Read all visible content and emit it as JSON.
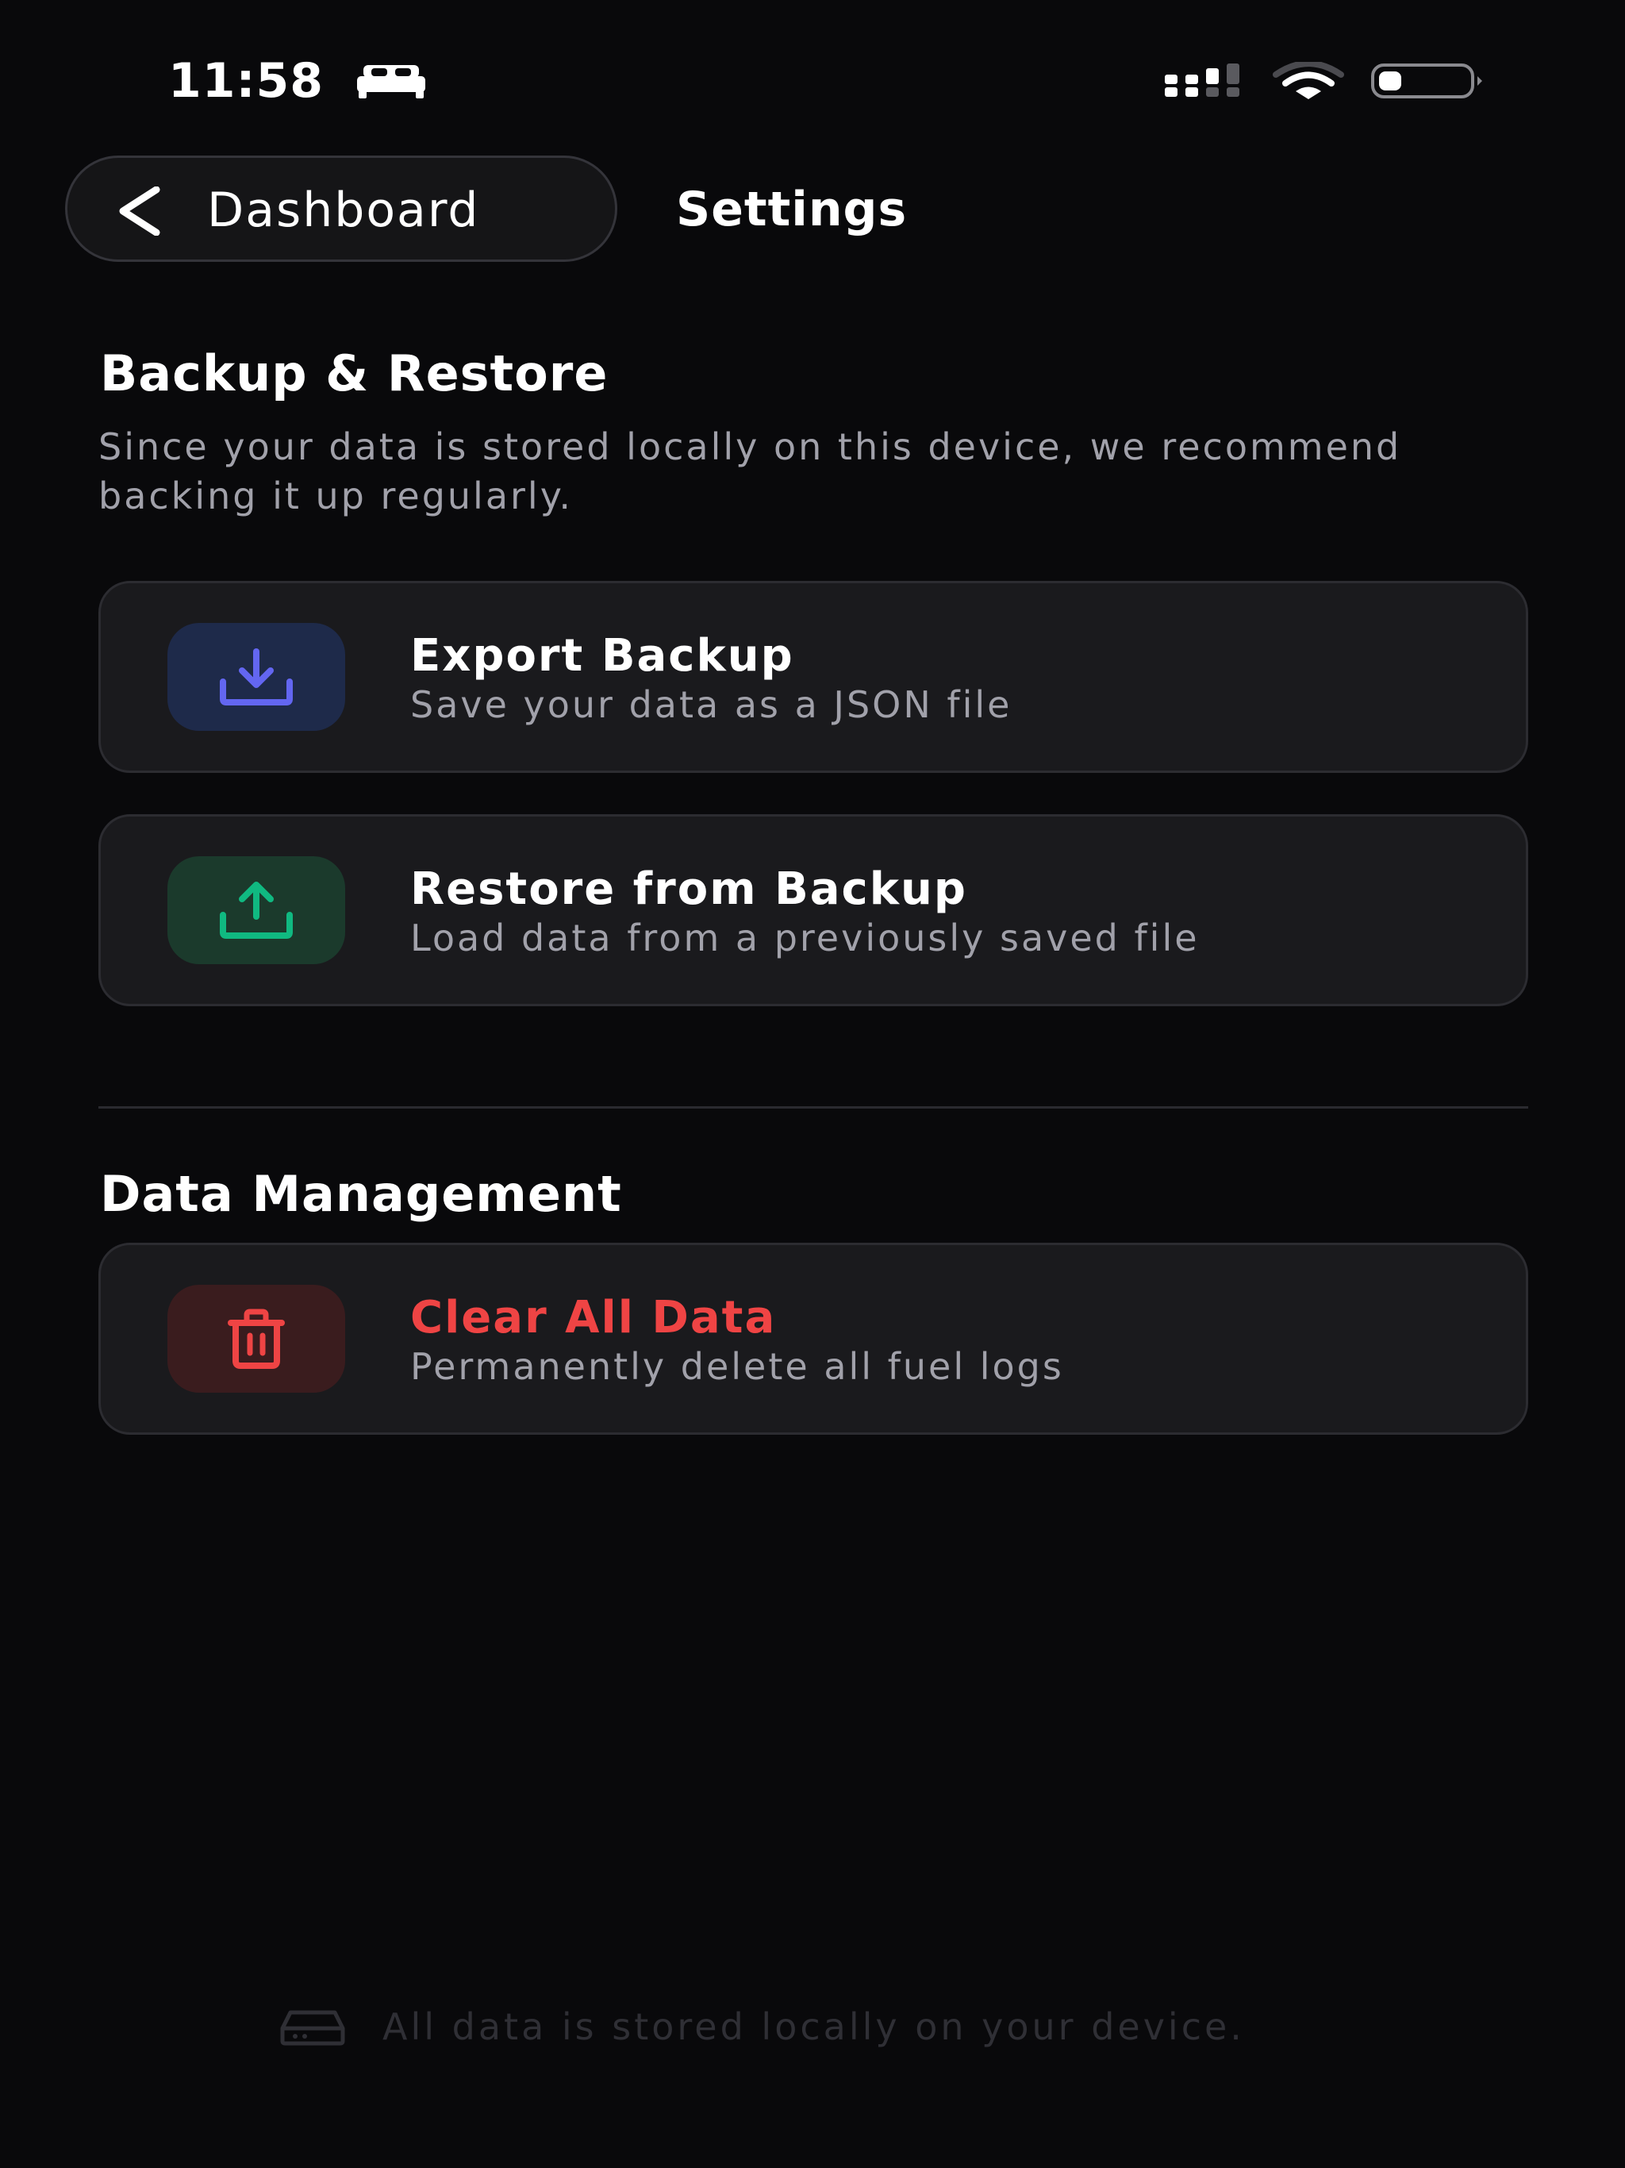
{
  "status_bar": {
    "time": "11:58"
  },
  "header": {
    "back_label": "Dashboard",
    "title": "Settings"
  },
  "backup_section": {
    "title": "Backup & Restore",
    "description": "Since your data is stored locally on this device, we recommend backing it up regularly.",
    "export": {
      "title": "Export Backup",
      "subtitle": "Save your data as a JSON file",
      "icon": "download-icon",
      "icon_color": "#6366f1",
      "icon_bg": "#1e2a4a"
    },
    "restore": {
      "title": "Restore from Backup",
      "subtitle": "Load data from a previously saved file",
      "icon": "upload-icon",
      "icon_color": "#10b981",
      "icon_bg": "#1b3a2c"
    }
  },
  "data_section": {
    "title": "Data Management",
    "clear": {
      "title": "Clear All Data",
      "subtitle": "Permanently delete all fuel logs",
      "icon": "trash-icon",
      "icon_color": "#ef4444",
      "icon_bg": "#3a1c1e",
      "title_color": "#ef4444"
    }
  },
  "footer": {
    "text": "All data is stored locally on your device.",
    "icon": "hard-drive-icon"
  }
}
